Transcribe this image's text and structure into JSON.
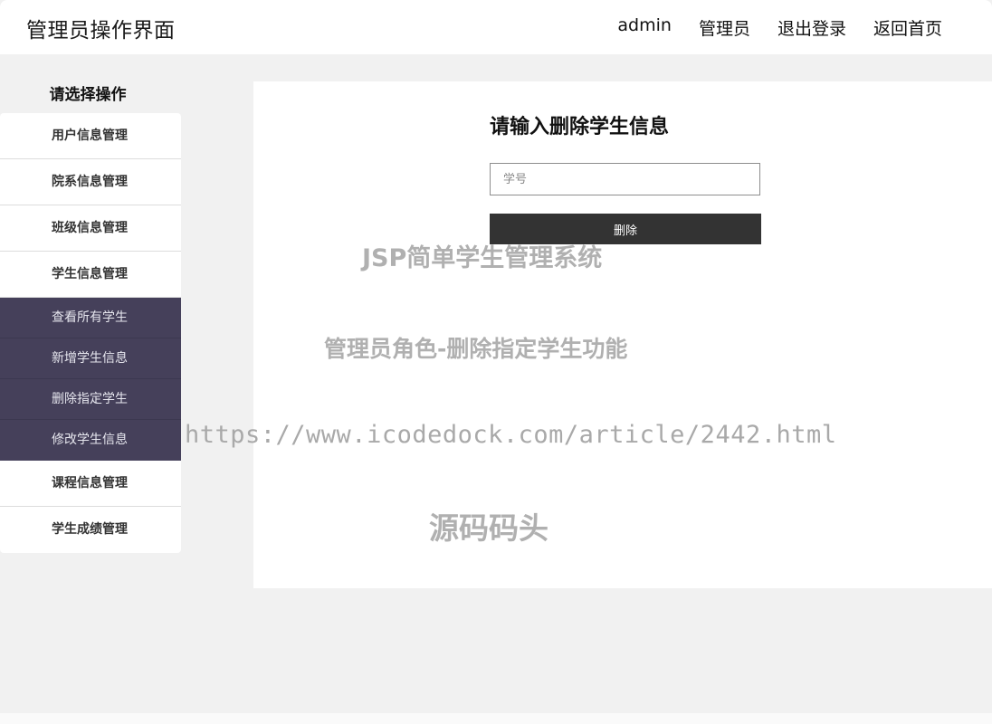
{
  "header": {
    "title": "管理员操作界面",
    "nav": {
      "user": "admin",
      "role": "管理员",
      "logout": "退出登录",
      "home": "返回首页"
    }
  },
  "sidebar": {
    "title": "请选择操作",
    "items": [
      {
        "label": "用户信息管理"
      },
      {
        "label": "院系信息管理"
      },
      {
        "label": "班级信息管理"
      },
      {
        "label": "学生信息管理"
      }
    ],
    "submenu": [
      {
        "label": "查看所有学生"
      },
      {
        "label": "新增学生信息"
      },
      {
        "label": "删除指定学生"
      },
      {
        "label": "修改学生信息"
      }
    ],
    "items_after": [
      {
        "label": "课程信息管理"
      },
      {
        "label": "学生成绩管理"
      }
    ]
  },
  "main": {
    "form_title": "请输入删除学生信息",
    "student_id": {
      "placeholder": "学号",
      "value": ""
    },
    "delete_label": "删除"
  },
  "watermarks": {
    "line1": "JSP简单学生管理系统",
    "line2": "管理员角色-删除指定学生功能",
    "line3": "https://www.icodedock.com/article/2442.html",
    "line4": "源码码头"
  },
  "colors": {
    "submenu_bg": "#45405a",
    "button_bg": "#333333",
    "page_bg": "#f1f1f1"
  }
}
